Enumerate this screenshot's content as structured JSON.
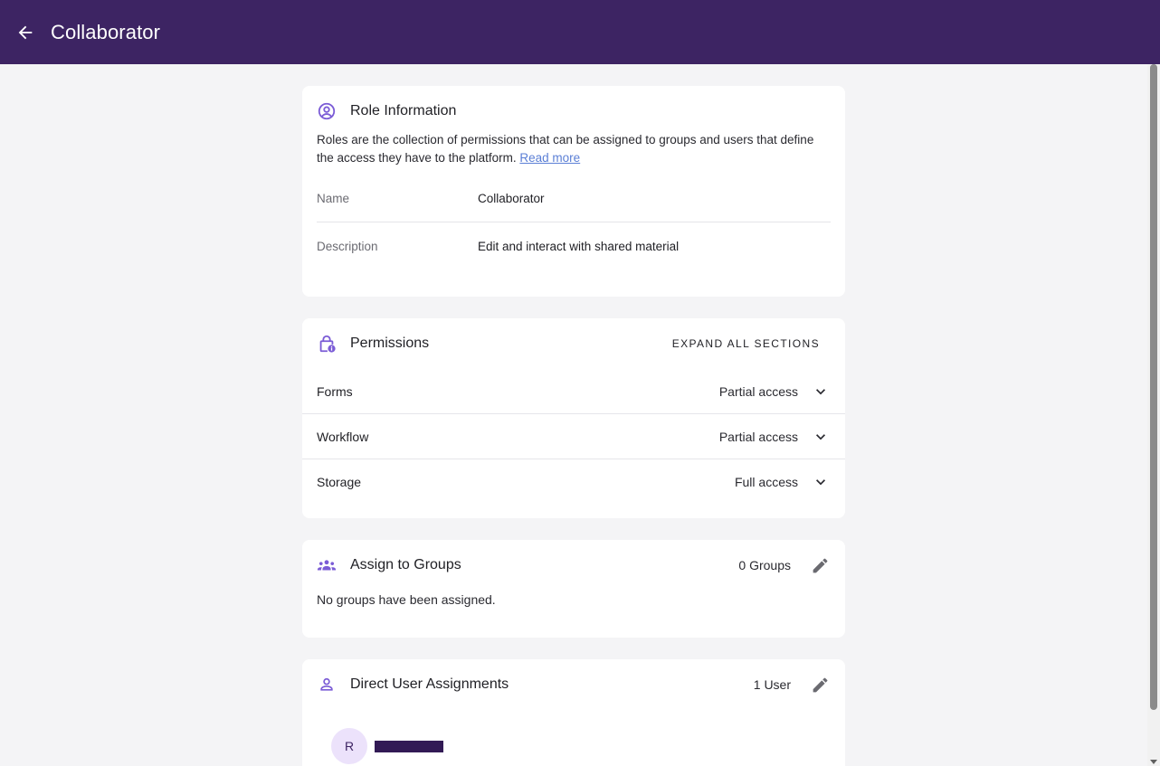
{
  "header": {
    "title": "Collaborator",
    "back_icon": "arrow-left-icon"
  },
  "role_info": {
    "title": "Role Information",
    "intro_text": "Roles are the collection of permissions that can be assigned to groups and users that define the access they have to the platform.",
    "read_more": "Read more",
    "fields": [
      {
        "label": "Name",
        "value": "Collaborator"
      },
      {
        "label": "Description",
        "value": "Edit and interact with shared material"
      }
    ]
  },
  "permissions": {
    "title": "Permissions",
    "expand_all": "EXPAND ALL SECTIONS",
    "items": [
      {
        "name": "Forms",
        "access": "Partial access"
      },
      {
        "name": "Workflow",
        "access": "Partial access"
      },
      {
        "name": "Storage",
        "access": "Full access"
      }
    ]
  },
  "groups": {
    "title": "Assign to Groups",
    "count": "0 Groups",
    "empty_text": "No groups have been assigned."
  },
  "users": {
    "title": "Direct User Assignments",
    "count": "1 User",
    "list": [
      {
        "initial": "R"
      }
    ]
  },
  "colors": {
    "brand": "#3d2463",
    "accent": "#7b5cd6",
    "link": "#5b7fd6"
  }
}
